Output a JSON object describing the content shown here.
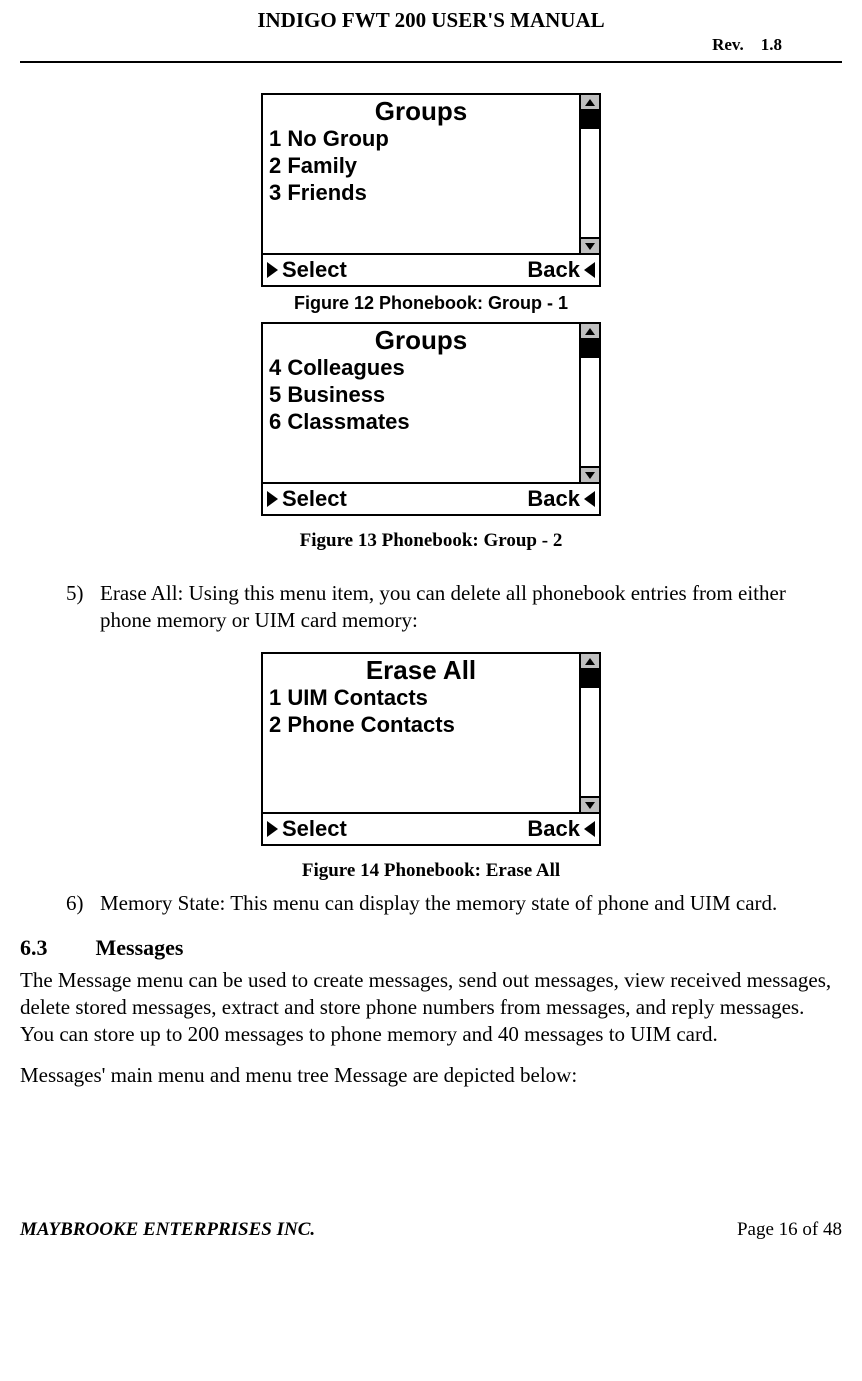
{
  "header": {
    "title": "INDIGO FWT 200 USER'S MANUAL",
    "rev_label": "Rev.",
    "rev_value": "1.8"
  },
  "screen1": {
    "title": "Groups",
    "items": [
      "1 No Group",
      "2 Family",
      "3 Friends"
    ],
    "select": "Select",
    "back": "Back"
  },
  "caption1": "Figure 12 Phonebook: Group - 1",
  "screen2": {
    "title": "Groups",
    "items": [
      "4 Colleagues",
      "5 Business",
      "6 Classmates"
    ],
    "select": "Select",
    "back": "Back"
  },
  "caption2": "Figure 13  Phonebook: Group - 2",
  "para5_num": "5)",
  "para5": "Erase All: Using this menu item, you can delete all phonebook entries from either phone memory or UIM card memory:",
  "screen3": {
    "title": "Erase All",
    "items": [
      "1 UIM Contacts",
      "",
      "2 Phone Contacts"
    ],
    "select": "Select",
    "back": "Back"
  },
  "caption3": "Figure 14  Phonebook: Erase All",
  "para6_num": "6)",
  "para6": "Memory State: This menu can display the memory state of phone and UIM card.",
  "section": {
    "num": "6.3",
    "title": "Messages"
  },
  "section_body1": "The Message menu can be used to create messages, send out  messages, view received messages, delete stored messages, extract and store phone numbers from messages, and reply messages. You can store up to 200 messages to phone memory and 40 messages to UIM card.",
  "section_body2": "Messages'  main menu and menu tree Message are depicted below:",
  "footer": {
    "company": "MAYBROOKE ENTERPRISES INC.",
    "page": "Page 16 of 48"
  }
}
